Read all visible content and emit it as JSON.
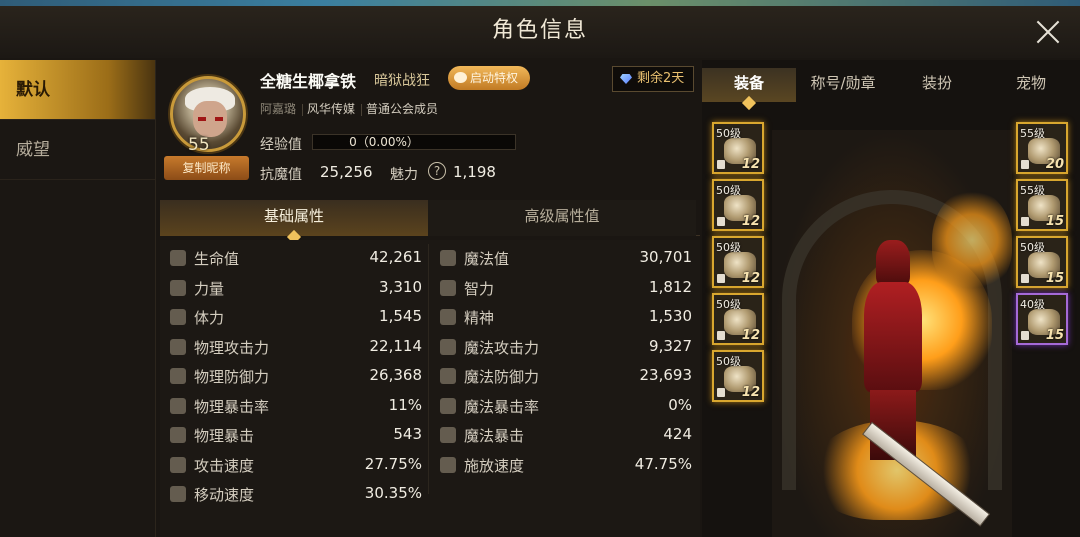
{
  "window": {
    "title": "角色信息"
  },
  "side_tabs": [
    {
      "label": "默认"
    },
    {
      "label": "威望"
    }
  ],
  "character": {
    "level": "55",
    "name": "全糖生椰拿铁",
    "class": "暗狱战狂",
    "privilege_button": "启动特权",
    "remaining": "剩余2天",
    "server": "阿嘉璐",
    "guild": "风华传媒",
    "guild_role": "普通公会成员",
    "copy_button": "复制昵称",
    "exp_label": "经验值",
    "exp_text": "0（0.00%）",
    "exp_progress": 0,
    "resist_label": "抗魔值",
    "resist_value": "25,256",
    "charm_label": "魅力",
    "charm_value": "1,198"
  },
  "attr_tabs": [
    {
      "label": "基础属性"
    },
    {
      "label": "高级属性值"
    }
  ],
  "stats_left": [
    {
      "label": "生命值",
      "value": "42,261",
      "icon": "heart-icon"
    },
    {
      "label": "力量",
      "value": "3,310",
      "icon": "fist-icon"
    },
    {
      "label": "体力",
      "value": "1,545",
      "icon": "body-icon"
    },
    {
      "label": "物理攻击力",
      "value": "22,114",
      "icon": "sword-icon"
    },
    {
      "label": "物理防御力",
      "value": "26,368",
      "icon": "shield-icon"
    },
    {
      "label": "物理暴击率",
      "value": "11%",
      "icon": "crosshair-icon"
    },
    {
      "label": "物理暴击",
      "value": "543",
      "icon": "crosshair-icon"
    },
    {
      "label": "攻击速度",
      "value": "27.75%",
      "icon": "slash-icon"
    },
    {
      "label": "移动速度",
      "value": "30.35%",
      "icon": "boot-icon"
    }
  ],
  "stats_right": [
    {
      "label": "魔法值",
      "value": "30,701",
      "icon": "heart-outline-icon"
    },
    {
      "label": "智力",
      "value": "1,812",
      "icon": "sparkle-icon"
    },
    {
      "label": "精神",
      "value": "1,530",
      "icon": "orb-icon"
    },
    {
      "label": "魔法攻击力",
      "value": "9,327",
      "icon": "star-burst-icon"
    },
    {
      "label": "魔法防御力",
      "value": "23,693",
      "icon": "yin-yang-icon"
    },
    {
      "label": "魔法暴击率",
      "value": "0%",
      "icon": "ring-icon"
    },
    {
      "label": "魔法暴击",
      "value": "424",
      "icon": "ring-icon"
    },
    {
      "label": "施放速度",
      "value": "47.75%",
      "icon": "hand-icon"
    }
  ],
  "equip_tabs": [
    {
      "label": "装备"
    },
    {
      "label": "称号/勋章"
    },
    {
      "label": "装扮"
    },
    {
      "label": "宠物"
    }
  ],
  "equip_left": [
    {
      "level": "50级",
      "refine": "12"
    },
    {
      "level": "50级",
      "refine": "12"
    },
    {
      "level": "50级",
      "refine": "12"
    },
    {
      "level": "50级",
      "refine": "12"
    },
    {
      "level": "50级",
      "refine": "12"
    }
  ],
  "equip_right": [
    {
      "level": "55级",
      "refine": "20"
    },
    {
      "level": "55级",
      "refine": "15"
    },
    {
      "level": "50级",
      "refine": "15"
    },
    {
      "level": "40级",
      "refine": "15"
    }
  ]
}
